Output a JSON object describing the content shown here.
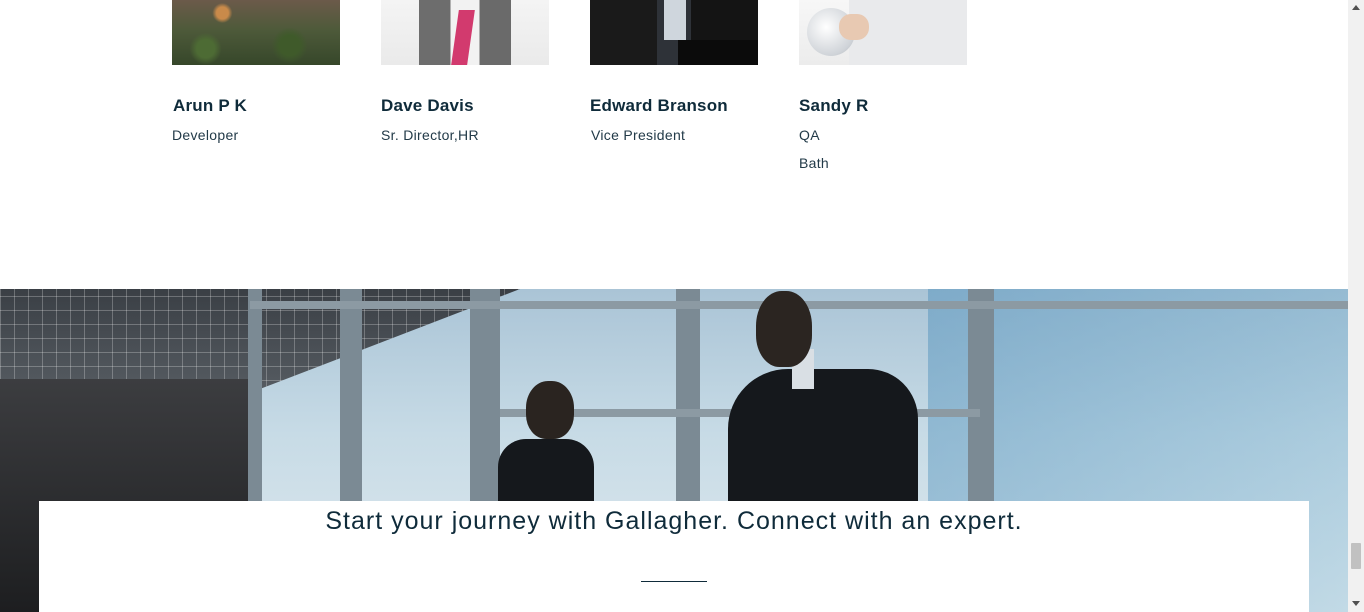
{
  "team": [
    {
      "name": "Arun P K",
      "role": "Developer",
      "location": ""
    },
    {
      "name": "Dave Davis",
      "role": "Sr. Director,HR",
      "location": ""
    },
    {
      "name": "Edward Branson",
      "role": "Vice President",
      "location": ""
    },
    {
      "name": "Sandy R",
      "role": "QA",
      "location": "Bath"
    }
  ],
  "cta": {
    "heading": "Start your journey with Gallagher. Connect with an expert."
  },
  "colors": {
    "text_primary": "#0f2b3a",
    "background": "#ffffff"
  }
}
